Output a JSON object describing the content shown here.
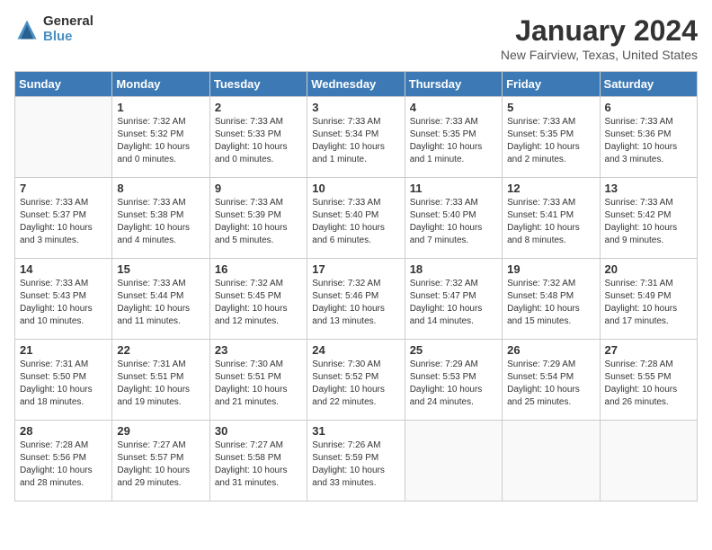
{
  "header": {
    "logo_general": "General",
    "logo_blue": "Blue",
    "month_title": "January 2024",
    "location": "New Fairview, Texas, United States"
  },
  "days_of_week": [
    "Sunday",
    "Monday",
    "Tuesday",
    "Wednesday",
    "Thursday",
    "Friday",
    "Saturday"
  ],
  "weeks": [
    [
      {
        "day": "",
        "info": ""
      },
      {
        "day": "1",
        "info": "Sunrise: 7:32 AM\nSunset: 5:32 PM\nDaylight: 10 hours\nand 0 minutes."
      },
      {
        "day": "2",
        "info": "Sunrise: 7:33 AM\nSunset: 5:33 PM\nDaylight: 10 hours\nand 0 minutes."
      },
      {
        "day": "3",
        "info": "Sunrise: 7:33 AM\nSunset: 5:34 PM\nDaylight: 10 hours\nand 1 minute."
      },
      {
        "day": "4",
        "info": "Sunrise: 7:33 AM\nSunset: 5:35 PM\nDaylight: 10 hours\nand 1 minute."
      },
      {
        "day": "5",
        "info": "Sunrise: 7:33 AM\nSunset: 5:35 PM\nDaylight: 10 hours\nand 2 minutes."
      },
      {
        "day": "6",
        "info": "Sunrise: 7:33 AM\nSunset: 5:36 PM\nDaylight: 10 hours\nand 3 minutes."
      }
    ],
    [
      {
        "day": "7",
        "info": "Sunrise: 7:33 AM\nSunset: 5:37 PM\nDaylight: 10 hours\nand 3 minutes."
      },
      {
        "day": "8",
        "info": "Sunrise: 7:33 AM\nSunset: 5:38 PM\nDaylight: 10 hours\nand 4 minutes."
      },
      {
        "day": "9",
        "info": "Sunrise: 7:33 AM\nSunset: 5:39 PM\nDaylight: 10 hours\nand 5 minutes."
      },
      {
        "day": "10",
        "info": "Sunrise: 7:33 AM\nSunset: 5:40 PM\nDaylight: 10 hours\nand 6 minutes."
      },
      {
        "day": "11",
        "info": "Sunrise: 7:33 AM\nSunset: 5:40 PM\nDaylight: 10 hours\nand 7 minutes."
      },
      {
        "day": "12",
        "info": "Sunrise: 7:33 AM\nSunset: 5:41 PM\nDaylight: 10 hours\nand 8 minutes."
      },
      {
        "day": "13",
        "info": "Sunrise: 7:33 AM\nSunset: 5:42 PM\nDaylight: 10 hours\nand 9 minutes."
      }
    ],
    [
      {
        "day": "14",
        "info": "Sunrise: 7:33 AM\nSunset: 5:43 PM\nDaylight: 10 hours\nand 10 minutes."
      },
      {
        "day": "15",
        "info": "Sunrise: 7:33 AM\nSunset: 5:44 PM\nDaylight: 10 hours\nand 11 minutes."
      },
      {
        "day": "16",
        "info": "Sunrise: 7:32 AM\nSunset: 5:45 PM\nDaylight: 10 hours\nand 12 minutes."
      },
      {
        "day": "17",
        "info": "Sunrise: 7:32 AM\nSunset: 5:46 PM\nDaylight: 10 hours\nand 13 minutes."
      },
      {
        "day": "18",
        "info": "Sunrise: 7:32 AM\nSunset: 5:47 PM\nDaylight: 10 hours\nand 14 minutes."
      },
      {
        "day": "19",
        "info": "Sunrise: 7:32 AM\nSunset: 5:48 PM\nDaylight: 10 hours\nand 15 minutes."
      },
      {
        "day": "20",
        "info": "Sunrise: 7:31 AM\nSunset: 5:49 PM\nDaylight: 10 hours\nand 17 minutes."
      }
    ],
    [
      {
        "day": "21",
        "info": "Sunrise: 7:31 AM\nSunset: 5:50 PM\nDaylight: 10 hours\nand 18 minutes."
      },
      {
        "day": "22",
        "info": "Sunrise: 7:31 AM\nSunset: 5:51 PM\nDaylight: 10 hours\nand 19 minutes."
      },
      {
        "day": "23",
        "info": "Sunrise: 7:30 AM\nSunset: 5:51 PM\nDaylight: 10 hours\nand 21 minutes."
      },
      {
        "day": "24",
        "info": "Sunrise: 7:30 AM\nSunset: 5:52 PM\nDaylight: 10 hours\nand 22 minutes."
      },
      {
        "day": "25",
        "info": "Sunrise: 7:29 AM\nSunset: 5:53 PM\nDaylight: 10 hours\nand 24 minutes."
      },
      {
        "day": "26",
        "info": "Sunrise: 7:29 AM\nSunset: 5:54 PM\nDaylight: 10 hours\nand 25 minutes."
      },
      {
        "day": "27",
        "info": "Sunrise: 7:28 AM\nSunset: 5:55 PM\nDaylight: 10 hours\nand 26 minutes."
      }
    ],
    [
      {
        "day": "28",
        "info": "Sunrise: 7:28 AM\nSunset: 5:56 PM\nDaylight: 10 hours\nand 28 minutes."
      },
      {
        "day": "29",
        "info": "Sunrise: 7:27 AM\nSunset: 5:57 PM\nDaylight: 10 hours\nand 29 minutes."
      },
      {
        "day": "30",
        "info": "Sunrise: 7:27 AM\nSunset: 5:58 PM\nDaylight: 10 hours\nand 31 minutes."
      },
      {
        "day": "31",
        "info": "Sunrise: 7:26 AM\nSunset: 5:59 PM\nDaylight: 10 hours\nand 33 minutes."
      },
      {
        "day": "",
        "info": ""
      },
      {
        "day": "",
        "info": ""
      },
      {
        "day": "",
        "info": ""
      }
    ]
  ]
}
